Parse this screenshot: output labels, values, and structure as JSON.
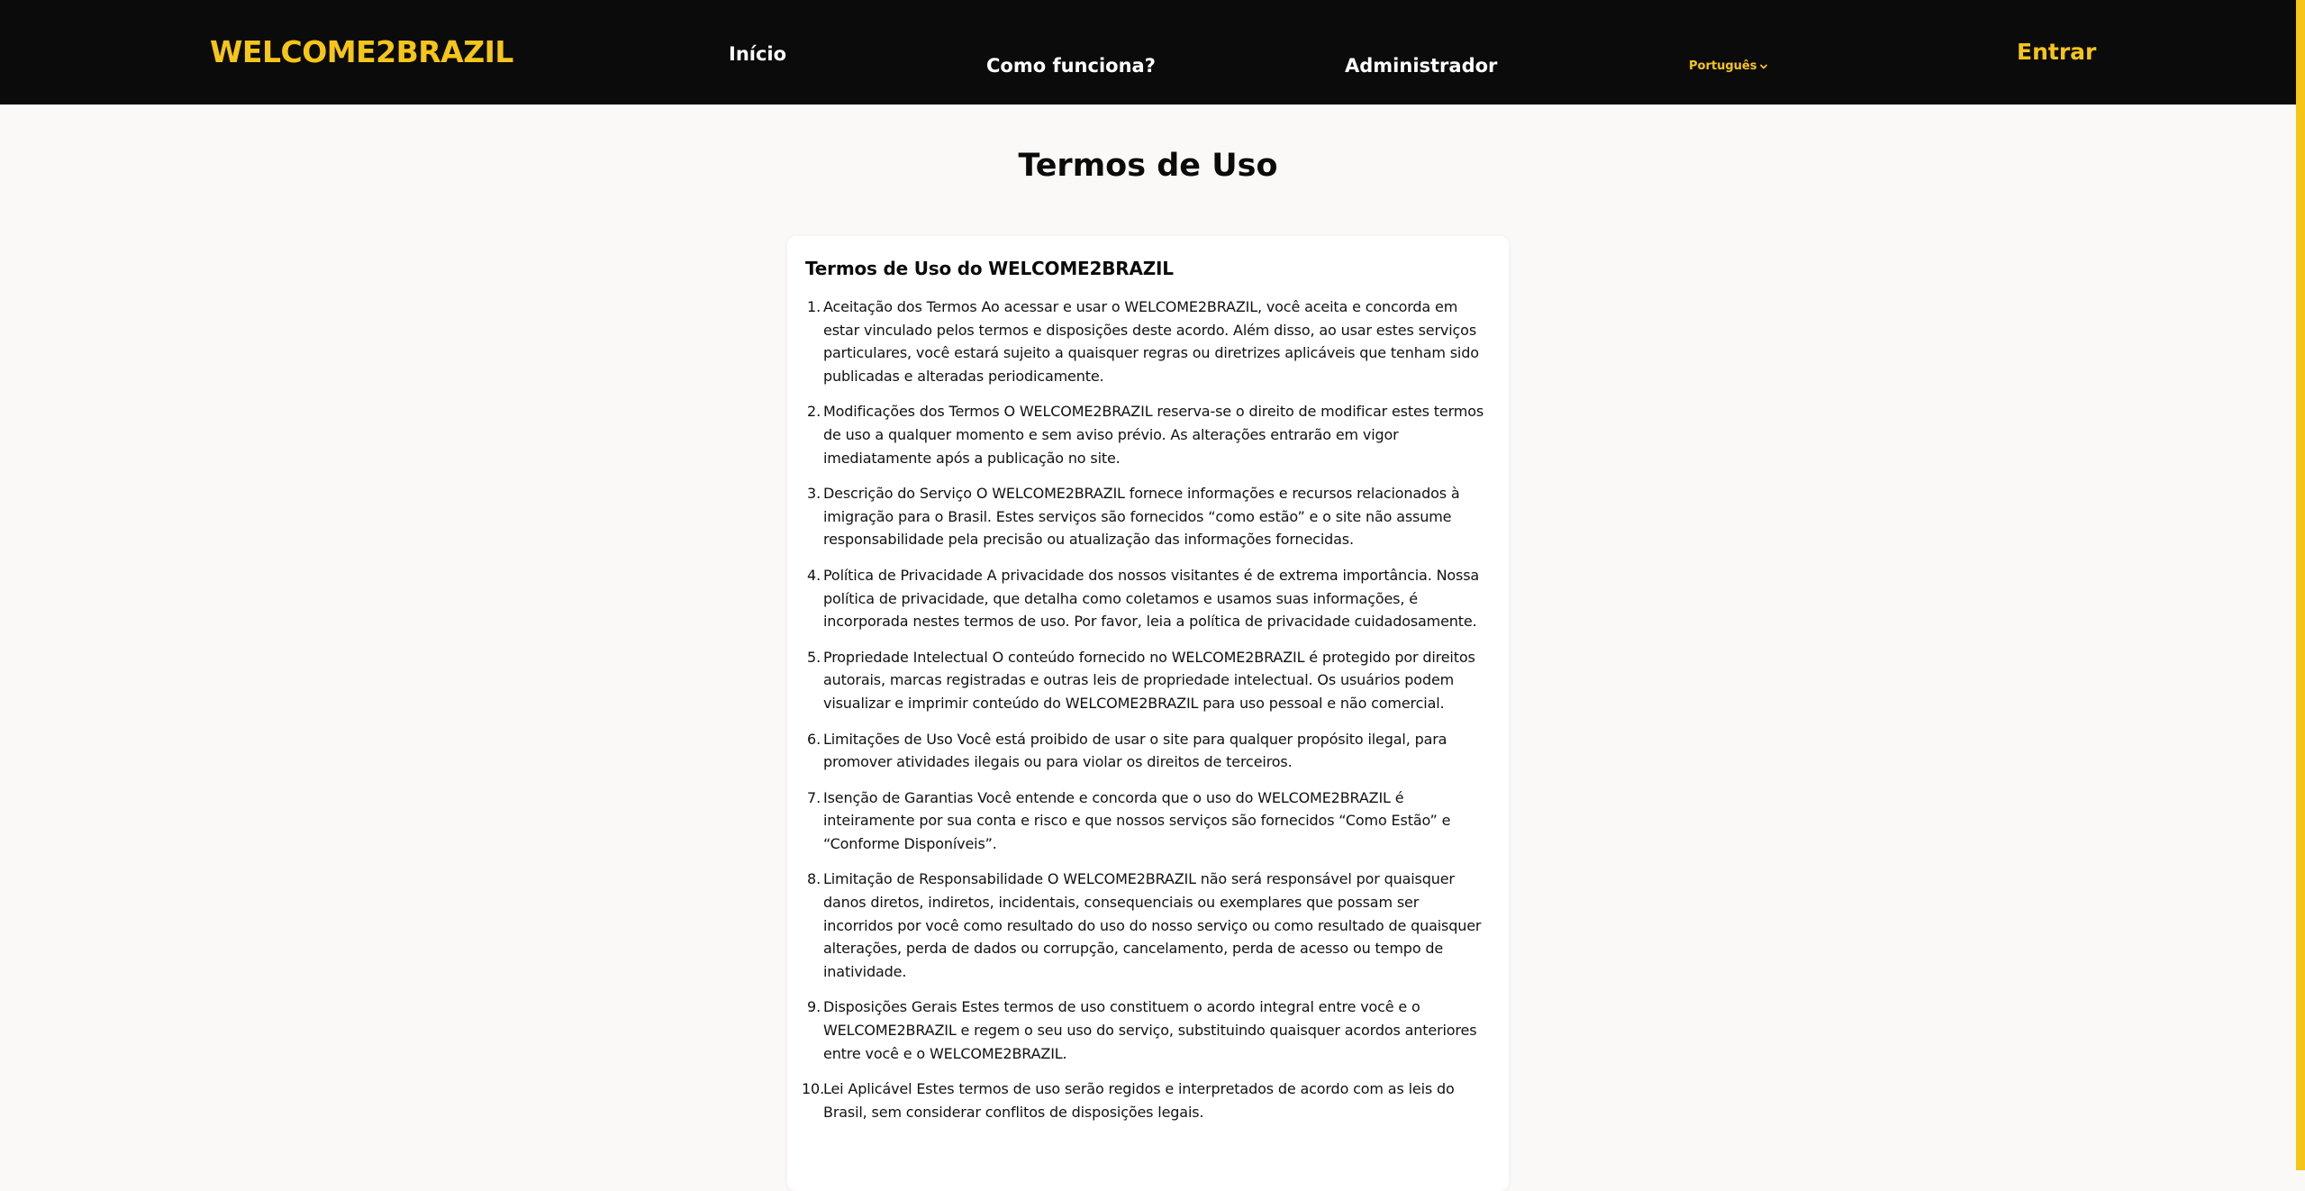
{
  "header": {
    "logo": "WELCOME2BRAZIL",
    "nav": {
      "inicio": "Início",
      "como_funciona": "Como funciona?",
      "administrador": "Administrador"
    },
    "language": "Português",
    "login": "Entrar"
  },
  "colors": {
    "accent": "#f5c518",
    "navbar": "#0b0b0b",
    "background": "#faf9f7"
  },
  "main": {
    "page_title": "Termos de Uso",
    "card_title": "Termos de Uso do WELCOME2BRAZIL",
    "terms": [
      "Aceitação dos Termos Ao acessar e usar o WELCOME2BRAZIL, você aceita e concorda em estar vinculado pelos termos e disposições deste acordo. Além disso, ao usar estes serviços particulares, você estará sujeito a quaisquer regras ou diretrizes aplicáveis que tenham sido publicadas e alteradas periodicamente.",
      "Modificações dos Termos O WELCOME2BRAZIL reserva-se o direito de modificar estes termos de uso a qualquer momento e sem aviso prévio. As alterações entrarão em vigor imediatamente após a publicação no site.",
      "Descrição do Serviço O WELCOME2BRAZIL fornece informações e recursos relacionados à imigração para o Brasil. Estes serviços são fornecidos “como estão” e o site não assume responsabilidade pela precisão ou atualização das informações fornecidas.",
      "Política de Privacidade A privacidade dos nossos visitantes é de extrema importância. Nossa política de privacidade, que detalha como coletamos e usamos suas informações, é incorporada nestes termos de uso. Por favor, leia a política de privacidade cuidadosamente.",
      "Propriedade Intelectual O conteúdo fornecido no WELCOME2BRAZIL é protegido por direitos autorais, marcas registradas e outras leis de propriedade intelectual. Os usuários podem visualizar e imprimir conteúdo do WELCOME2BRAZIL para uso pessoal e não comercial.",
      "Limitações de Uso Você está proibido de usar o site para qualquer propósito ilegal, para promover atividades ilegais ou para violar os direitos de terceiros.",
      "Isenção de Garantias Você entende e concorda que o uso do WELCOME2BRAZIL é inteiramente por sua conta e risco e que nossos serviços são fornecidos “Como Estão” e “Conforme Disponíveis”.",
      "Limitação de Responsabilidade O WELCOME2BRAZIL não será responsável por quaisquer danos diretos, indiretos, incidentais, consequenciais ou exemplares que possam ser incorridos por você como resultado do uso do nosso serviço ou como resultado de quaisquer alterações, perda de dados ou corrupção, cancelamento, perda de acesso ou tempo de inatividade.",
      "Disposições Gerais Estes termos de uso constituem o acordo integral entre você e o WELCOME2BRAZIL e regem o seu uso do serviço, substituindo quaisquer acordos anteriores entre você e o WELCOME2BRAZIL.",
      "Lei Aplicável Estes termos de uso serão regidos e interpretados de acordo com as leis do Brasil, sem considerar conflitos de disposições legais."
    ]
  }
}
